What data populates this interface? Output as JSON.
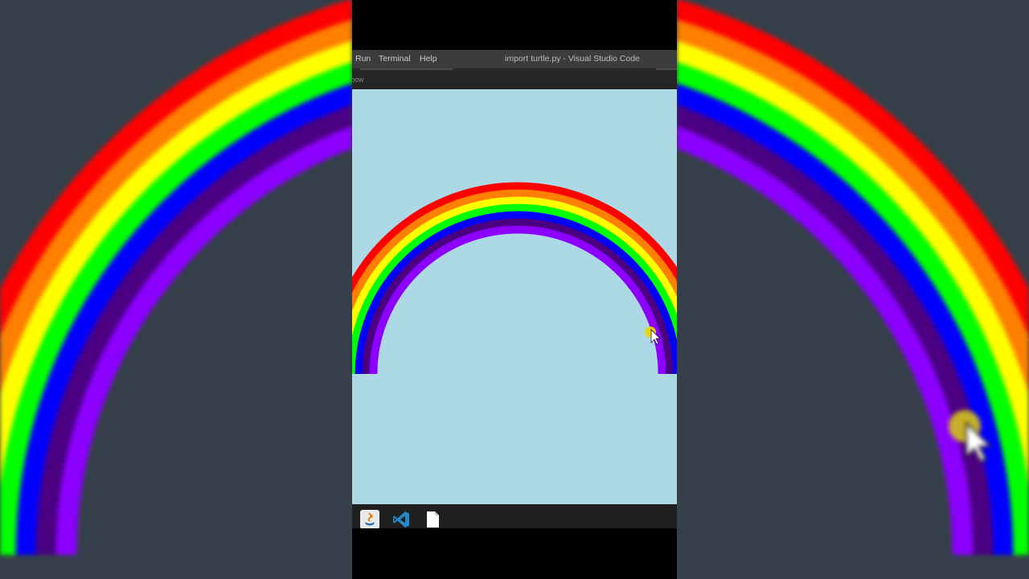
{
  "menu": {
    "items": [
      "Run",
      "Terminal",
      "Help"
    ]
  },
  "window": {
    "title": "import turtle.py - Visual Studio Code"
  },
  "editor": {
    "tab_label": "bow"
  },
  "turtle_canvas": {
    "background_color": "#add8e6",
    "rainbow_colors": [
      "#ff0000",
      "#ff7f00",
      "#ffff00",
      "#00ff00",
      "#0000ff",
      "#4b0082",
      "#8b00ff"
    ]
  },
  "taskbar": {
    "icons": [
      "java-app-icon",
      "vscode-icon",
      "file-icon"
    ]
  }
}
